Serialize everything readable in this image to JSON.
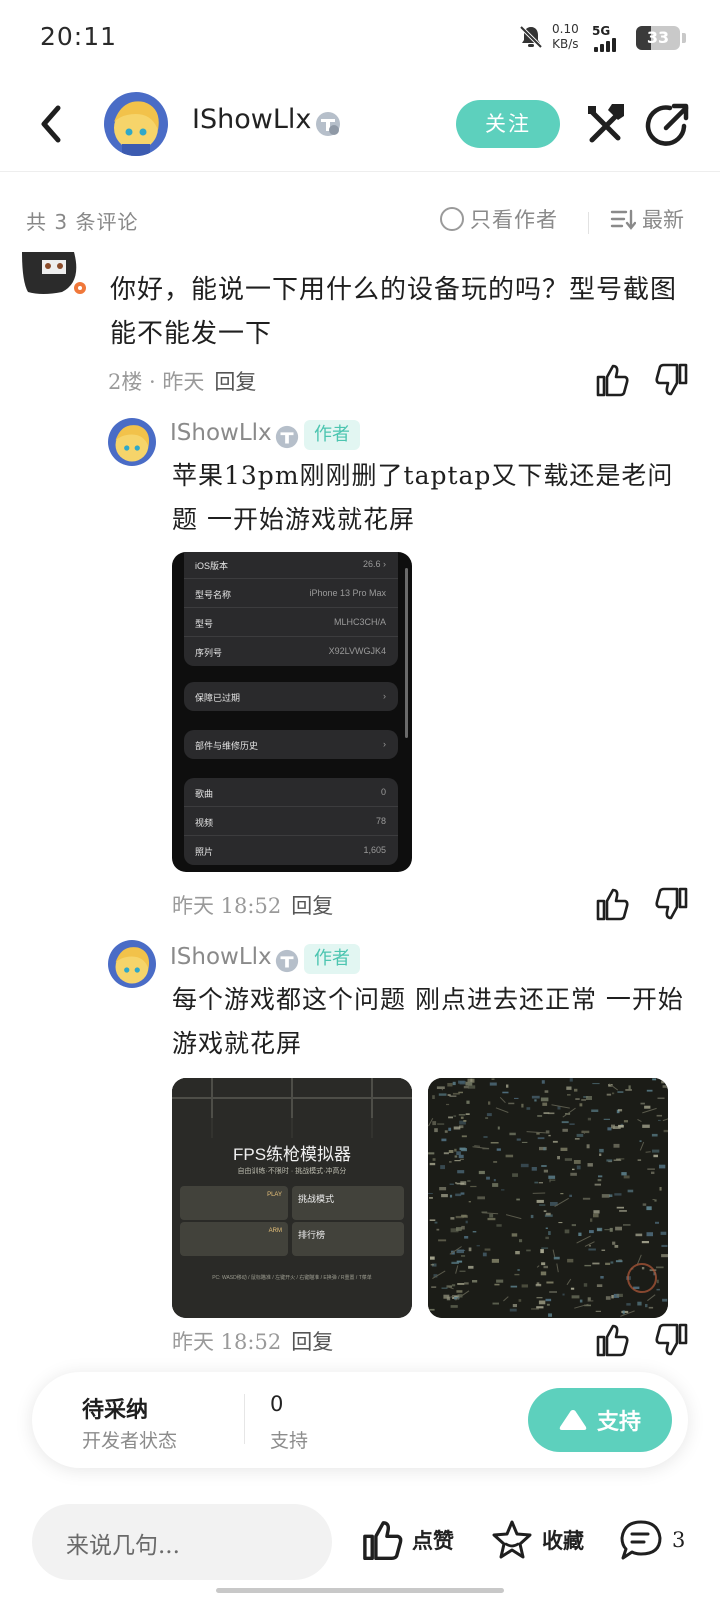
{
  "status_bar": {
    "time": "20:11",
    "net_speed": "0.10",
    "net_unit": "KB/s",
    "network_type": "5G",
    "battery": "33",
    "battery_level_percent": 33
  },
  "header": {
    "username": "IShowLlx",
    "follow_label": "关注",
    "icons": [
      "back-icon",
      "avatar",
      "verified-badge-icon",
      "tools-icon",
      "share-icon"
    ]
  },
  "comments_bar": {
    "count_label": "共 3 条评论",
    "only_author_label": "只看作者",
    "sort_label": "最新"
  },
  "floor": {
    "text": "你好，能说一下用什么的设备玩的吗？型号截图能不能发一下",
    "meta": "2楼 · 昨天",
    "reply_label": "回复"
  },
  "replies": [
    {
      "name": "IShowLlx",
      "tag": "作者",
      "text": "苹果13pm刚刚删了taptap又下载还是老问题 一开始游戏就花屏",
      "time": "昨天 18:52",
      "reply_label": "回复",
      "image": {
        "groups": [
          [
            {
              "k": "iOS版本",
              "v": "26.6 ›"
            },
            {
              "k": "型号名称",
              "v": "iPhone 13 Pro Max"
            },
            {
              "k": "型号",
              "v": "MLHC3CH/A"
            },
            {
              "k": "序列号",
              "v": "X92LVWGJK4"
            }
          ],
          [
            {
              "k": "保障已过期",
              "v": "›"
            }
          ],
          [
            {
              "k": "部件与维修历史",
              "v": "›"
            }
          ],
          [
            {
              "k": "歌曲",
              "v": "0"
            },
            {
              "k": "视频",
              "v": "78"
            },
            {
              "k": "照片",
              "v": "1,605"
            }
          ]
        ]
      }
    },
    {
      "name": "IShowLlx",
      "tag": "作者",
      "text": "每个游戏都这个问题 刚点进去还正常 一开始游戏就花屏",
      "time": "昨天 18:52",
      "reply_label": "回复",
      "fps_image": {
        "title": "FPS练枪模拟器",
        "subtitle": "自由训练·不限时  ·  挑战模式·冲高分",
        "card1": "PLAY",
        "card2": "挑战模式",
        "card3": "ARM",
        "card4": "排行榜",
        "footer": "PC: WASD移动 / 鼠标瞄准 / 左键开火 / 右键瞄准 / E换弹 / R重置 / T菜单"
      }
    }
  ],
  "status_card": {
    "title": "待采纳",
    "subtitle": "开发者状态",
    "support_count": "0",
    "support_count_label": "支持",
    "support_button": "支持"
  },
  "bottom_bar": {
    "input_placeholder": "来说几句...",
    "like_label": "点赞",
    "fav_label": "收藏",
    "comment_count": "3"
  },
  "colors": {
    "accent": "#5dd0bd",
    "author_tag_bg": "#e2f6f2",
    "author_tag_text": "#4cc5b0"
  }
}
